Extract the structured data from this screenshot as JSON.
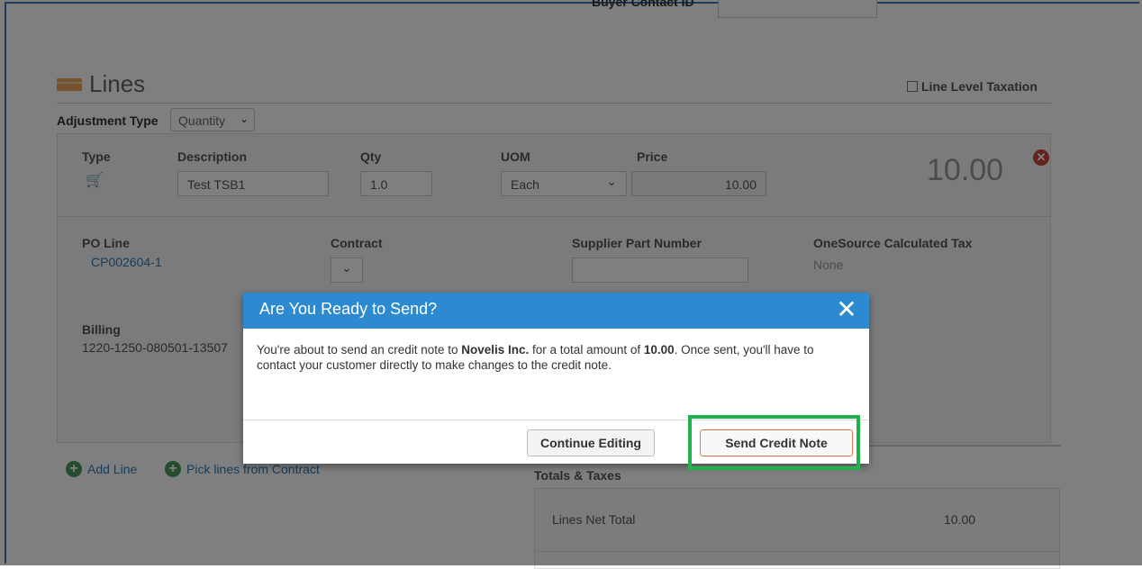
{
  "header": {
    "buyer_contact_label": "Buyer Contact ID",
    "buyer_contact_value": ""
  },
  "lines_section": {
    "title": "Lines",
    "line_level_taxation_label": "Line Level Taxation",
    "adjustment_type_label": "Adjustment Type",
    "adjustment_type_value": "Quantity"
  },
  "line": {
    "type_header": "Type",
    "description_header": "Description",
    "qty_header": "Qty",
    "uom_header": "UOM",
    "price_header": "Price",
    "description_value": "Test TSB1",
    "qty_value": "1.0",
    "uom_value": "Each",
    "price_value": "10.00",
    "line_total": "10.00",
    "po_line_label": "PO Line",
    "po_line_value": "CP002604-1",
    "contract_label": "Contract",
    "supplier_part_label": "Supplier Part Number",
    "onesource_label": "OneSource Calculated Tax",
    "onesource_value": "None",
    "billing_label": "Billing",
    "billing_value": "1220-1250-080501-13507"
  },
  "actions": {
    "add_line": "Add Line",
    "pick_lines": "Pick lines from Contract"
  },
  "totals": {
    "title": "Totals & Taxes",
    "lines_net_total_label": "Lines Net Total",
    "lines_net_total_value": "10.00"
  },
  "modal": {
    "title": "Are You Ready to Send?",
    "body_pre": "You're about to send an credit note to ",
    "customer": "Novelis Inc.",
    "body_mid": " for a total amount of ",
    "amount": "10.00",
    "body_post": ". Once sent, you'll have to contact your customer directly to make changes to the credit note.",
    "continue_label": "Continue Editing",
    "send_label": "Send Credit Note"
  },
  "colors": {
    "modal_header": "#2d8ad0",
    "highlight": "#22b14c",
    "link": "#2a7ab8"
  }
}
